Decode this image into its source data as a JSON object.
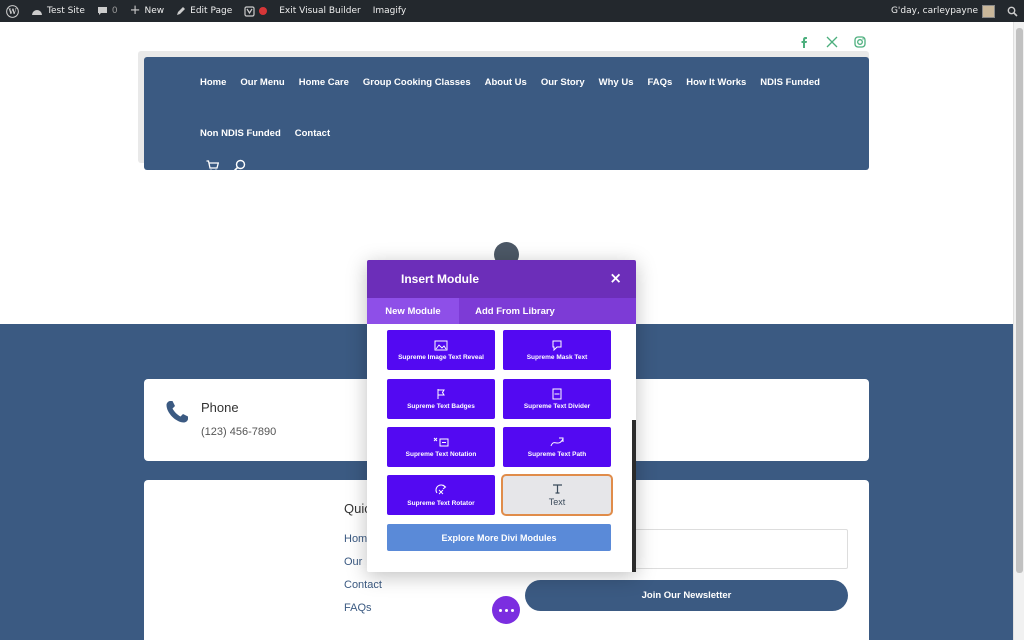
{
  "admin_bar": {
    "site_name": "Test Site",
    "comments_count": "0",
    "new_label": "New",
    "edit_page_label": "Edit Page",
    "exit_builder_label": "Exit Visual Builder",
    "imagify_label": "Imagify",
    "greeting": "G'day, carleypayne"
  },
  "social_icons": [
    "facebook-icon",
    "x-icon",
    "instagram-icon"
  ],
  "nav": {
    "row1": [
      "Home",
      "Our Menu",
      "Home Care",
      "Group Cooking Classes",
      "About Us",
      "Our Story",
      "Why Us",
      "FAQs",
      "How It Works",
      "NDIS Funded"
    ],
    "row2": [
      "Non NDIS Funded",
      "Contact"
    ]
  },
  "modal": {
    "title": "Insert Module",
    "close_label": "×",
    "tabs": [
      "New Module",
      "Add From Library"
    ],
    "modules": [
      {
        "label": "Supreme Image Text Reveal",
        "icon": "image-reveal-icon"
      },
      {
        "label": "Supreme Mask Text",
        "icon": "mask-icon"
      },
      {
        "label": "Supreme Text Badges",
        "icon": "badge-icon"
      },
      {
        "label": "Supreme Text Divider",
        "icon": "divider-icon"
      },
      {
        "label": "Supreme Text Notation",
        "icon": "notation-icon"
      },
      {
        "label": "Supreme Text Path",
        "icon": "path-icon"
      },
      {
        "label": "Supreme Text Rotator",
        "icon": "rotator-icon"
      },
      {
        "label": "Text",
        "icon": "text-icon"
      }
    ],
    "explore_label": "Explore More Divi Modules"
  },
  "phone": {
    "title": "Phone",
    "number": "(123) 456-7890"
  },
  "footer": {
    "quick_title": "Quic",
    "links": [
      "Home",
      "Our",
      "Contact",
      "FAQs"
    ],
    "join_label": "Join Our Newsletter"
  },
  "colors": {
    "admin_bar": "#23282d",
    "nav_blue": "#3b5a82",
    "modal_purple": "#6c2eb9",
    "module_tile": "#5309f2",
    "social_green": "#4caf7d"
  }
}
